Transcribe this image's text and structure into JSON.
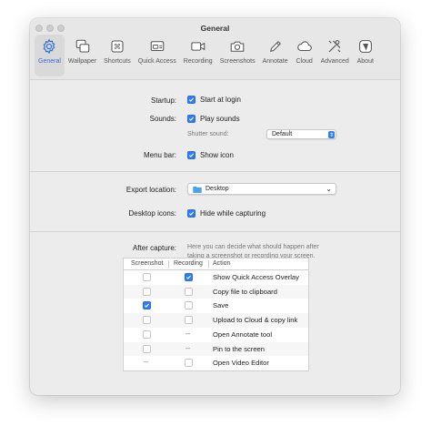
{
  "window": {
    "title": "General"
  },
  "tabs": [
    {
      "label": "General",
      "icon": "gear-icon",
      "active": true
    },
    {
      "label": "Wallpaper",
      "icon": "wallpaper-icon"
    },
    {
      "label": "Shortcuts",
      "icon": "command-key-icon"
    },
    {
      "label": "Quick Access",
      "icon": "quick-access-icon"
    },
    {
      "label": "Recording",
      "icon": "video-camera-icon"
    },
    {
      "label": "Screenshots",
      "icon": "camera-icon"
    },
    {
      "label": "Annotate",
      "icon": "pencil-icon"
    },
    {
      "label": "Cloud",
      "icon": "cloud-icon"
    },
    {
      "label": "Advanced",
      "icon": "tools-icon"
    },
    {
      "label": "About",
      "icon": "app-icon"
    }
  ],
  "general": {
    "startup_label": "Startup:",
    "start_at_login": "Start at login",
    "sounds_label": "Sounds:",
    "play_sounds": "Play sounds",
    "shutter_sound_label": "Shutter sound:",
    "shutter_sound_value": "Default",
    "menubar_label": "Menu bar:",
    "show_icon": "Show icon",
    "export_location_label": "Export location:",
    "export_location_value": "Desktop",
    "desktop_icons_label": "Desktop icons:",
    "hide_while_capturing": "Hide while capturing",
    "after_capture_label": "After capture:",
    "after_capture_help": "Here you can decide what should happen after taking a screenshot or recording your screen."
  },
  "after_capture_table": {
    "columns": [
      "Screenshot",
      "Recording",
      "Action"
    ],
    "rows": [
      {
        "screenshot": "off",
        "recording": "on",
        "action": "Show Quick Access Overlay"
      },
      {
        "screenshot": "off",
        "recording": "off",
        "action": "Copy file to clipboard"
      },
      {
        "screenshot": "on",
        "recording": "off",
        "action": "Save"
      },
      {
        "screenshot": "off",
        "recording": "off",
        "action": "Upload to Cloud & copy link"
      },
      {
        "screenshot": "off",
        "recording": "na",
        "action": "Open Annotate tool"
      },
      {
        "screenshot": "off",
        "recording": "na",
        "action": "Pin to the screen"
      },
      {
        "screenshot": "na",
        "recording": "off",
        "action": "Open Video Editor"
      }
    ]
  },
  "colors": {
    "accent": "#2f7cf6",
    "active_tab": "#2f6fd6",
    "window_bg": "#ececec"
  }
}
